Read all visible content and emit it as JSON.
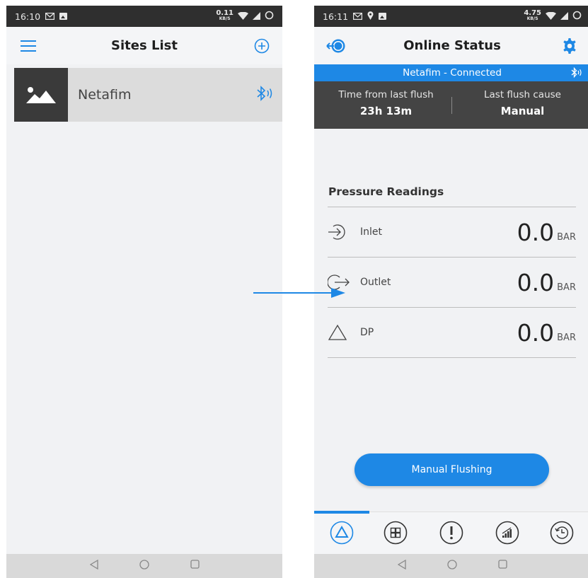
{
  "left_screen": {
    "status_bar": {
      "time": "16:10",
      "speed_value": "0.11",
      "speed_unit": "KB/S"
    },
    "app_bar": {
      "title": "Sites List"
    },
    "sites": [
      {
        "name": "Netafim"
      }
    ]
  },
  "right_screen": {
    "status_bar": {
      "time": "16:11",
      "speed_value": "4.75",
      "speed_unit": "KB/S"
    },
    "app_bar": {
      "title": "Online Status"
    },
    "connection": {
      "text": "Netafim - Connected"
    },
    "flush_info": {
      "time_label": "Time from last flush",
      "time_value": "23h 13m",
      "cause_label": "Last flush cause",
      "cause_value": "Manual"
    },
    "pressure": {
      "title": "Pressure Readings",
      "readings": [
        {
          "name": "Inlet",
          "value": "0.0",
          "unit": "BAR",
          "icon": "inlet-arrow-icon"
        },
        {
          "name": "Outlet",
          "value": "0.0",
          "unit": "BAR",
          "icon": "outlet-arrow-icon"
        },
        {
          "name": "DP",
          "value": "0.0",
          "unit": "BAR",
          "icon": "triangle-icon"
        }
      ]
    },
    "manual_flush_label": "Manual Flushing",
    "tabs": [
      {
        "icon": "triangle-tab-icon",
        "active": true
      },
      {
        "icon": "grid-tab-icon",
        "active": false
      },
      {
        "icon": "alert-tab-icon",
        "active": false
      },
      {
        "icon": "signal-tab-icon",
        "active": false
      },
      {
        "icon": "history-tab-icon",
        "active": false
      }
    ]
  },
  "colors": {
    "accent": "#1e88e5",
    "status_bar": "#2f2f2f",
    "dark_panel": "#444444"
  }
}
